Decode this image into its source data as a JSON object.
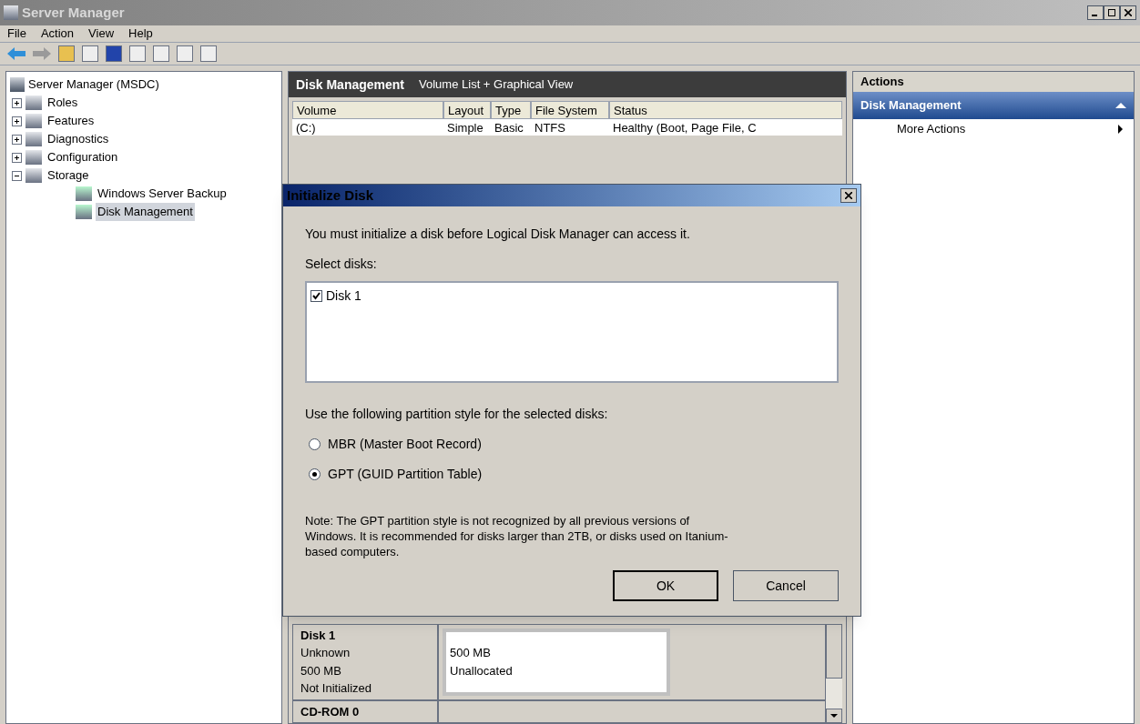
{
  "window": {
    "title": "Server Manager"
  },
  "menu": [
    "File",
    "Action",
    "View",
    "Help"
  ],
  "tree": {
    "label": "Server Manager (MSDC)",
    "children": [
      {
        "label": "Roles",
        "expanded": false,
        "selected": false
      },
      {
        "label": "Features",
        "expanded": false,
        "selected": false
      },
      {
        "label": "Diagnostics",
        "expanded": false,
        "selected": false
      },
      {
        "label": "Configuration",
        "expanded": false,
        "selected": false
      },
      {
        "label": "Storage",
        "expanded": true,
        "selected": false,
        "children": [
          {
            "label": "Windows Server Backup",
            "selected": false
          },
          {
            "label": "Disk Management",
            "selected": true
          }
        ]
      }
    ]
  },
  "center": {
    "title": "Disk Management",
    "subtitle": "Volume List + Graphical View",
    "columns": [
      "Volume",
      "Layout",
      "Type",
      "File System",
      "Status"
    ],
    "rows": [
      [
        "(C:)",
        "Simple",
        "Basic",
        "NTFS",
        "Healthy (Boot, Page File, C"
      ]
    ],
    "disks": [
      {
        "name": "Disk 1",
        "details": [
          "Unknown",
          "500 MB",
          "Not Initialized"
        ],
        "partition": [
          "500 MB",
          "Unallocated"
        ]
      },
      {
        "name": "CD-ROM 0"
      }
    ]
  },
  "actions": {
    "title": "Actions",
    "section": "Disk Management",
    "items": [
      "More Actions"
    ]
  },
  "dialog": {
    "title": "Initialize Disk",
    "message": "You must initialize a disk before Logical Disk Manager can access it.",
    "select_label": "Select disks:",
    "disks": [
      {
        "label": "Disk 1",
        "checked": true
      }
    ],
    "style_label": "Use the following partition style for the selected disks:",
    "options": [
      {
        "label": "MBR (Master Boot Record)",
        "selected": false
      },
      {
        "label": "GPT (GUID Partition Table)",
        "selected": true
      }
    ],
    "note": "Note: The GPT partition style is not recognized by all previous versions of Windows. It is recommended for disks larger than 2TB, or disks used on Itanium-based computers.",
    "buttons": [
      "OK",
      "Cancel"
    ]
  }
}
